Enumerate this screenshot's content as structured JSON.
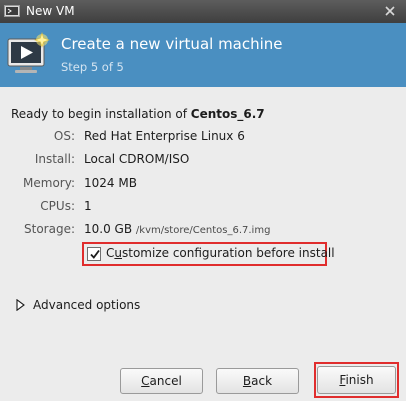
{
  "window": {
    "title": "New VM",
    "app_icon": "monitor-icon",
    "close_icon": "close-icon"
  },
  "banner": {
    "title": "Create a new virtual machine",
    "step": "Step 5 of 5",
    "icon": "vm-monitor-star-icon",
    "background": "#4a8fc1"
  },
  "summary": {
    "intro": "Ready to begin installation of ",
    "vm_name": "Centos_6.7",
    "rows": [
      {
        "label": "OS:",
        "value": "Red Hat Enterprise Linux 6"
      },
      {
        "label": "Install:",
        "value": "Local CDROM/ISO"
      },
      {
        "label": "Memory:",
        "value": "1024 MB"
      },
      {
        "label": "CPUs:",
        "value": "1"
      },
      {
        "label": "Storage:",
        "value": "10.0 GB",
        "path": "/kvm/store/Centos_6.7.img"
      }
    ]
  },
  "customize": {
    "label_accel": "u",
    "label_prefix": "C",
    "label_rest": "stomize configuration before install",
    "checked": true
  },
  "advanced": {
    "label": "Advanced options",
    "icon": "triangle-right-icon"
  },
  "buttons": {
    "cancel": {
      "accel": "C",
      "rest": "ancel"
    },
    "back": {
      "accel": "B",
      "rest": "ack"
    },
    "finish": {
      "accel": "F",
      "rest": "inish"
    }
  },
  "highlight_color": "#e02d2d"
}
